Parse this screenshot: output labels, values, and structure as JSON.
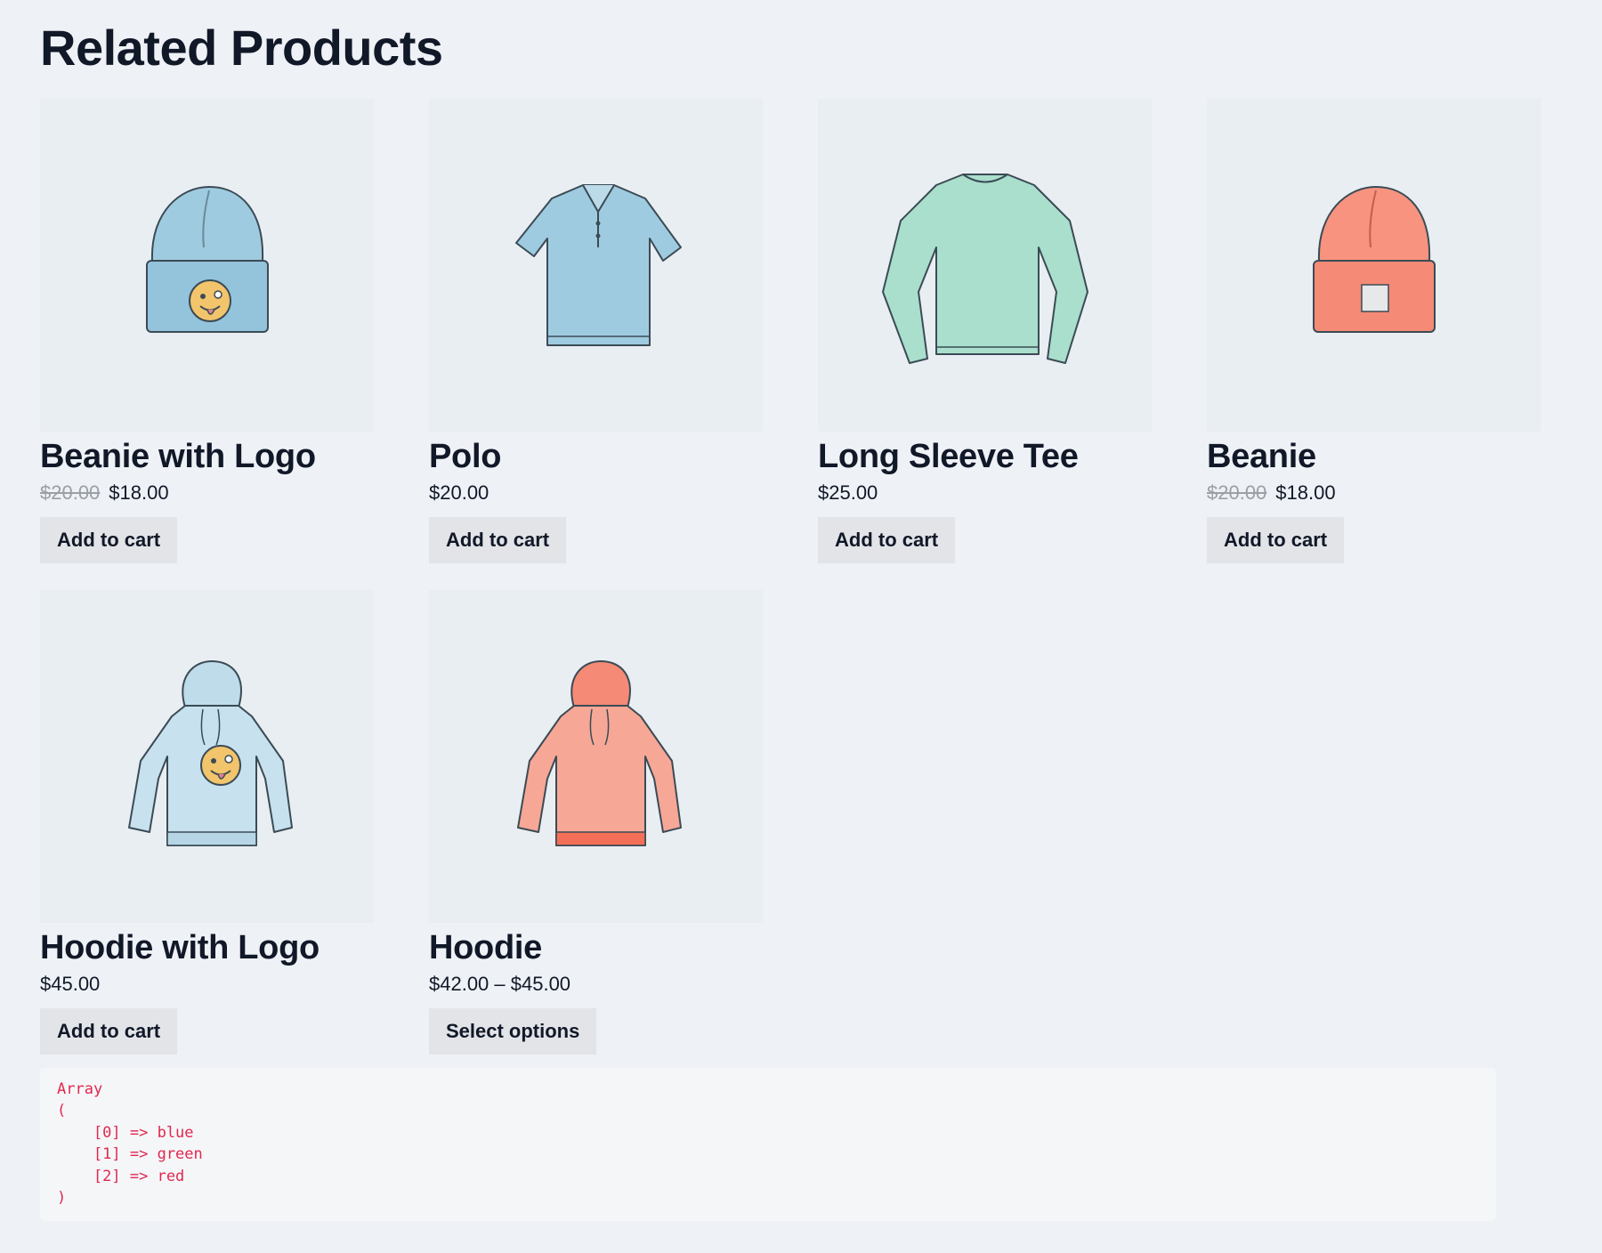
{
  "section": {
    "title": "Related Products"
  },
  "products": [
    {
      "name": "Beanie with Logo",
      "old_price": "$20.00",
      "price": "$18.00",
      "button": "Add to cart",
      "image": "beanie-logo-image"
    },
    {
      "name": "Polo",
      "old_price": "",
      "price": "$20.00",
      "button": "Add to cart",
      "image": "polo-shirt-image"
    },
    {
      "name": "Long Sleeve Tee",
      "old_price": "",
      "price": "$25.00",
      "button": "Add to cart",
      "image": "long-sleeve-tee-image"
    },
    {
      "name": "Beanie",
      "old_price": "$20.00",
      "price": "$18.00",
      "button": "Add to cart",
      "image": "beanie-image"
    },
    {
      "name": "Hoodie with Logo",
      "old_price": "",
      "price": "$45.00",
      "button": "Add to cart",
      "image": "hoodie-logo-image"
    },
    {
      "name": "Hoodie",
      "old_price": "",
      "price": "$42.00 – $45.00",
      "button": "Select options",
      "image": "hoodie-image"
    }
  ],
  "debug": {
    "text": "Array\n(\n    [0] => blue\n    [1] => green\n    [2] => red\n)"
  },
  "colors": {
    "background": "#eef1f6",
    "thumb": "#e9eef2",
    "button": "#e2e4e8",
    "blue_item": "#9fcbe0",
    "green_item": "#a9dfcc",
    "red_item": "#f7937f",
    "debug_text": "#e0284f"
  }
}
